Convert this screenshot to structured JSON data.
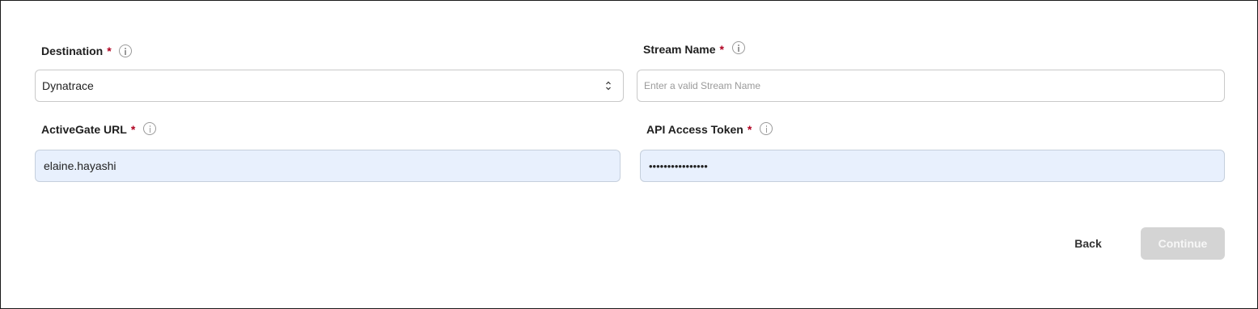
{
  "form": {
    "destination": {
      "label": "Destination",
      "required_mark": "*",
      "value": "Dynatrace"
    },
    "stream_name": {
      "label": "Stream Name",
      "required_mark": "*",
      "placeholder": "Enter a valid Stream Name",
      "value": ""
    },
    "activegate_url": {
      "label": "ActiveGate URL",
      "required_mark": "*",
      "value": "elaine.hayashi"
    },
    "api_access_token": {
      "label": "API Access Token",
      "required_mark": "*",
      "masked_value": "••••••••••••••••"
    }
  },
  "actions": {
    "back_label": "Back",
    "continue_label": "Continue"
  },
  "icons": {
    "info": "info-icon",
    "select_arrows": "chevron-up-down-icon"
  },
  "colors": {
    "required": "#b00020",
    "autofill_bg": "#e8f0fd",
    "disabled_button": "#d4d4d4"
  }
}
